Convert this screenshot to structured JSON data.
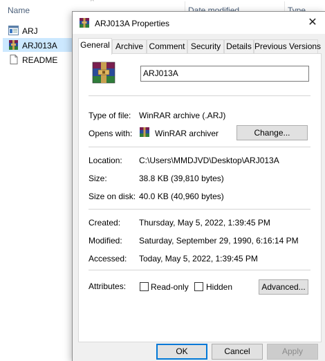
{
  "explorer": {
    "columns": {
      "name": "Name",
      "date_modified": "Date modified",
      "type": "Type"
    },
    "files": [
      {
        "label": "ARJ",
        "icon": "window-file-icon"
      },
      {
        "label": "ARJ013A",
        "icon": "winrar-archive-icon",
        "selected": true
      },
      {
        "label": "README",
        "icon": "blank-document-icon"
      }
    ]
  },
  "dialog": {
    "title": "ARJ013A Properties",
    "tabs": [
      "General",
      "Archive",
      "Comment",
      "Security",
      "Details",
      "Previous Versions"
    ],
    "active_tab": "General",
    "filename": "ARJ013A",
    "fields": {
      "type_label": "Type of file:",
      "type_value": "WinRAR archive (.ARJ)",
      "opens_label": "Opens with:",
      "opens_value": "WinRAR archiver",
      "change_button": "Change...",
      "location_label": "Location:",
      "location_value": "C:\\Users\\MMDJVD\\Desktop\\ARJ013A",
      "size_label": "Size:",
      "size_value": "38.8 KB (39,810 bytes)",
      "size_on_disk_label": "Size on disk:",
      "size_on_disk_value": "40.0 KB (40,960 bytes)",
      "created_label": "Created:",
      "created_value": "Thursday, May 5, 2022, 1:39:45 PM",
      "modified_label": "Modified:",
      "modified_value": "Saturday, September 29, 1990, 6:16:14 PM",
      "accessed_label": "Accessed:",
      "accessed_value": "Today, May 5, 2022, 1:39:45 PM",
      "attributes_label": "Attributes:",
      "readonly_label": "Read-only",
      "hidden_label": "Hidden",
      "advanced_button": "Advanced..."
    },
    "buttons": {
      "ok": "OK",
      "cancel": "Cancel",
      "apply": "Apply"
    },
    "colors": {
      "accent": "#0078d7",
      "selection": "#cce8ff"
    }
  }
}
